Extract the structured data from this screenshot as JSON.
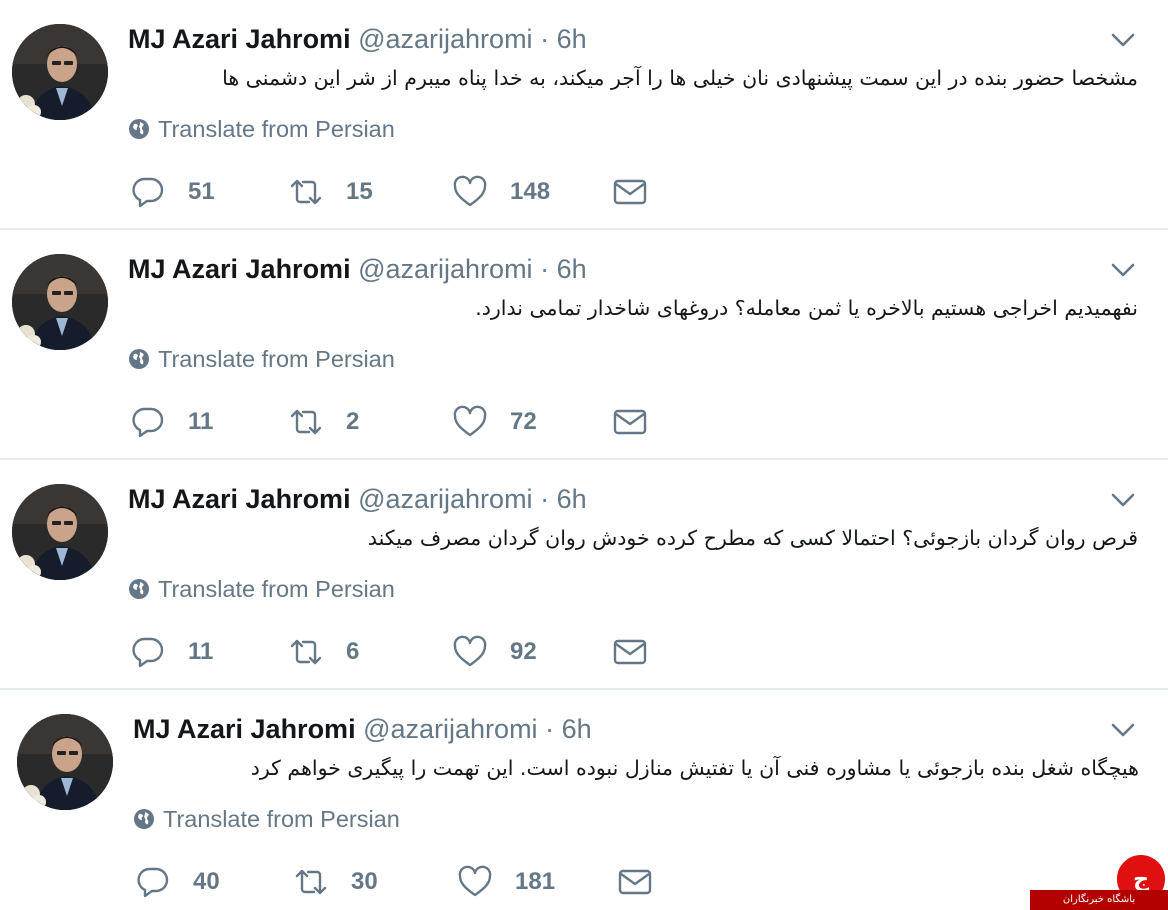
{
  "tweets": [
    {
      "name": "MJ Azari Jahromi",
      "handle": "@azarijahromi",
      "separator": "·",
      "time": "6h",
      "text": "مشخصا حضور بنده در این سمت پیشنهادی نان خیلی ها را آجر میکند، به خدا پناه میبرم از شر این دشمنی ها",
      "translate": "Translate from Persian",
      "replies": "51",
      "retweets": "15",
      "likes": "148"
    },
    {
      "name": "MJ Azari Jahromi",
      "handle": "@azarijahromi",
      "separator": "·",
      "time": "6h",
      "text": "نفهمیدیم اخراجی هستیم بالاخره یا ثمن معامله؟ دروغهای شاخدار تمامی ندارد.",
      "translate": "Translate from Persian",
      "replies": "11",
      "retweets": "2",
      "likes": "72"
    },
    {
      "name": "MJ Azari Jahromi",
      "handle": "@azarijahromi",
      "separator": "·",
      "time": "6h",
      "text": "قرص روان گردان بازجوئی؟ احتمالا کسی که مطرح کرده خودش روان گردان مصرف میکند",
      "translate": "Translate from Persian",
      "replies": "11",
      "retweets": "6",
      "likes": "92"
    },
    {
      "name": "MJ Azari Jahromi",
      "handle": "@azarijahromi",
      "separator": "·",
      "time": "6h",
      "text": "هیچگاه شغل بنده بازجوئی یا مشاوره فنی آن یا تفتیش منازل نبوده است. این تهمت را پیگیری خواهم کرد",
      "translate": "Translate from Persian",
      "replies": "40",
      "retweets": "30",
      "likes": "181"
    }
  ],
  "watermark": {
    "symbol": "ج",
    "label": "باشگاه خبرنگاران"
  },
  "colors": {
    "text": "#14171a",
    "muted": "#657786",
    "divider": "#e6ecf0",
    "watermark_red": "#e01010"
  },
  "icons": [
    "reply-icon",
    "retweet-icon",
    "like-icon",
    "direct-message-icon",
    "globe-icon",
    "chevron-down-icon"
  ]
}
